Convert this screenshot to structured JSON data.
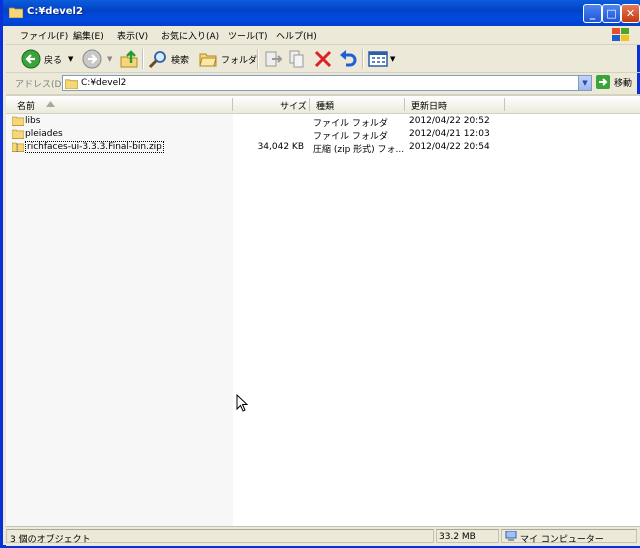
{
  "window": {
    "title": "C:¥devel2"
  },
  "menu": [
    "ファイル(F)",
    "編集(E)",
    "表示(V)",
    "お気に入り(A)",
    "ツール(T)",
    "ヘルプ(H)"
  ],
  "toolbar": {
    "back": "戻る",
    "search": "検索",
    "folders": "フォルダ"
  },
  "address": {
    "label": "アドレス(D)",
    "value": "C:¥devel2",
    "go": "移動"
  },
  "columns": {
    "name": "名前",
    "size": "サイズ",
    "type": "種類",
    "modified": "更新日時"
  },
  "files": [
    {
      "name": "libs",
      "size": "",
      "type": "ファイル フォルダ",
      "modified": "2012/04/22 20:52"
    },
    {
      "name": "pleiades",
      "size": "",
      "type": "ファイル フォルダ",
      "modified": "2012/04/21 12:03"
    },
    {
      "name": "richfaces-ui-3.3.3.Final-bin.zip",
      "size": "34,042 KB",
      "type": "圧縮 (zip 形式) フォ...",
      "modified": "2012/04/22 20:54"
    }
  ],
  "status": {
    "objects": "3 個のオブジェクト",
    "size": "33.2 MB",
    "location": "マイ コンピューター"
  }
}
